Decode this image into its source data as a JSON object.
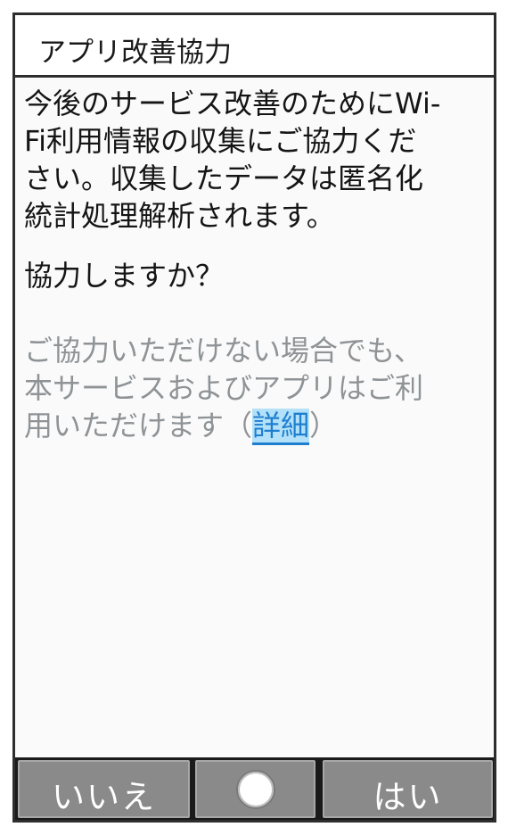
{
  "dialog": {
    "title": "アプリ改善協力",
    "body_lines": [
      "今後のサービス改善のためにWi-",
      "Fi利用情報の収集にご協力くだ",
      "さい。収集したデータは匿名化",
      "統計処理解析されます。"
    ],
    "question": "協力しますか？",
    "note_lines": [
      "ご協力いただけない場合でも、",
      "本サービスおよびアプリはご利"
    ],
    "note_last_prefix": "用いただけます（",
    "details_link": "詳細",
    "note_last_suffix": "）"
  },
  "softkeys": {
    "left_label": "いいえ",
    "center_icon": "circle-icon",
    "right_label": "はい"
  },
  "colors": {
    "link": "#1f7fcf",
    "link_highlight": "#b3e1f9",
    "muted_text": "#8f9396",
    "softkey_bg": "#8a8a8a"
  }
}
